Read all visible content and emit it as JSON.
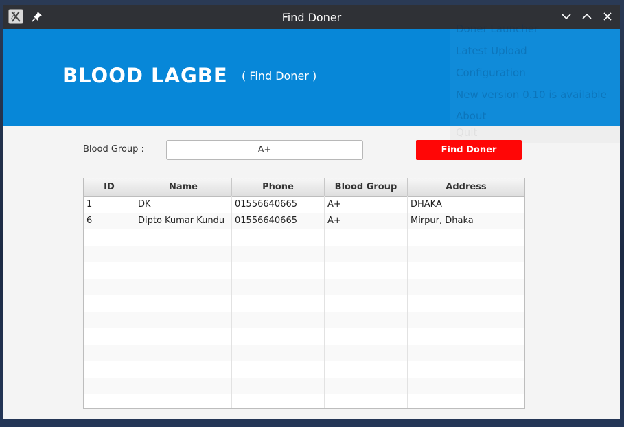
{
  "window": {
    "title": "Find Doner"
  },
  "header": {
    "brand": "BLOOD LAGBE",
    "subtitle": "( Find Doner )"
  },
  "background_menu": {
    "items": [
      "Doner Launcher",
      "Latest Upload",
      "Configuration",
      "New version 0.10 is available",
      "About",
      "Quit"
    ]
  },
  "form": {
    "blood_group_label": "Blood Group :",
    "blood_group_value": "A+",
    "find_button_label": "Find Doner"
  },
  "table": {
    "columns": [
      "ID",
      "Name",
      "Phone",
      "Blood Group",
      "Address"
    ],
    "rows": [
      [
        "1",
        "DK",
        "01556640665",
        "A+",
        "DHAKA"
      ],
      [
        "6",
        "Dipto Kumar Kundu",
        "01556640665",
        "A+",
        "Mirpur, Dhaka"
      ]
    ]
  },
  "colors": {
    "header_blue": "#0787d8",
    "button_red": "#ff0606",
    "titlebar": "#2f3136"
  }
}
